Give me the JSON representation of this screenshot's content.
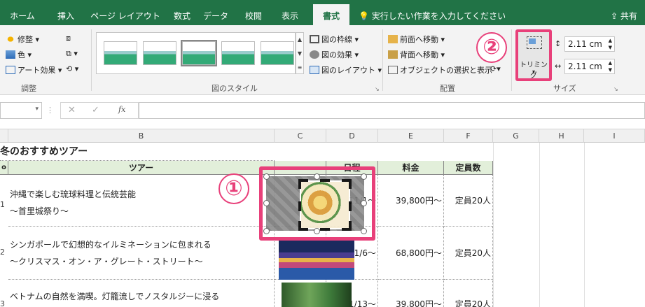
{
  "colors": {
    "brand": "#217346",
    "highlight": "#e8407a",
    "header_fill": "#e2efda"
  },
  "tabs": [
    "ホーム",
    "挿入",
    "ページ レイアウト",
    "数式",
    "データ",
    "校閲",
    "表示",
    "書式"
  ],
  "active_tab": "書式",
  "tell_me": "実行したい作業を入力してください",
  "share": "共有",
  "ribbon": {
    "adjust": {
      "correction": "修整",
      "color": "色",
      "art_effects": "アート効果",
      "label": "調整"
    },
    "styles": {
      "border": "図の枠線",
      "effects": "図の効果",
      "layout": "図のレイアウト",
      "label": "図のスタイル"
    },
    "arrange": {
      "bring_forward": "前面へ移動",
      "send_backward": "背面へ移動",
      "selection_pane": "オブジェクトの選択と表示",
      "label": "配置"
    },
    "size": {
      "crop": "トリミング",
      "height": "2.11 cm",
      "width": "2.11 cm",
      "label": "サイズ"
    }
  },
  "formula_bar": {
    "fx": "fx",
    "cancel": "✕",
    "confirm": "✓",
    "value": ""
  },
  "sheet": {
    "columns": [
      "B",
      "C",
      "D",
      "E",
      "F",
      "G",
      "H",
      "I"
    ],
    "title": "冬のおすすめツアー",
    "headers": {
      "tour": "ツアー",
      "date": "日程",
      "price": "料金",
      "capacity": "定員数"
    },
    "partial_header_a": "o",
    "rows": [
      {
        "num": "1",
        "line1": "沖縄で楽しむ琉球料理と伝統芸能",
        "line2": "〜首里城祭り〜",
        "date": "11/1〜",
        "price": "39,800円〜",
        "capacity": "定員20人"
      },
      {
        "num": "2",
        "line1": "シンガポールで幻想的なイルミネーションに包まれる",
        "line2": "〜クリスマス・オン・ア・グレート・ストリート〜",
        "date": "1/6〜",
        "price": "68,800円〜",
        "capacity": "定員20人"
      },
      {
        "num": "3",
        "line1": "ベトナムの自然を満喫。灯籠流しでノスタルジーに浸る",
        "line2": "",
        "date": "1/13〜",
        "price": "39,800円〜",
        "capacity": "定員20人"
      }
    ]
  },
  "callouts": {
    "one": "①",
    "two": "②"
  }
}
